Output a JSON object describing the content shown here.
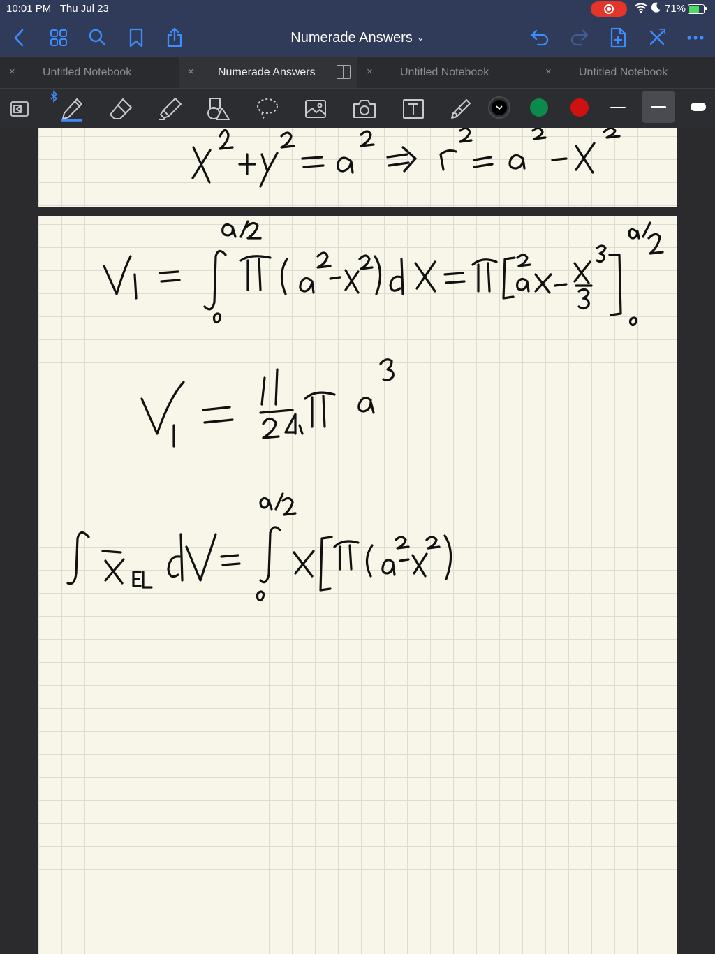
{
  "status_bar": {
    "time": "10:01 PM",
    "date": "Thu Jul 23",
    "battery": "71%",
    "record_color": "#e5352b"
  },
  "nav": {
    "title": "Numerade Answers",
    "title_chevron": "⌄",
    "icons": [
      "back-icon",
      "grid-icon",
      "search-icon",
      "bookmark-icon",
      "share-icon",
      "undo-icon",
      "redo-icon",
      "add-page-icon",
      "close-icon",
      "more-icon"
    ]
  },
  "tabs": [
    {
      "label": "Untitled Notebook",
      "close": "×",
      "active": false
    },
    {
      "label": "Numerade Answers",
      "close": "×",
      "active": true
    },
    {
      "label": "Untitled Notebook",
      "close": "×",
      "active": false
    },
    {
      "label": "Untitled Notebook",
      "close": "×",
      "active": false
    }
  ],
  "toolbar": {
    "tools": [
      "zoom-box",
      "pen",
      "eraser",
      "highlighter",
      "shapes",
      "lasso",
      "image",
      "camera",
      "text",
      "laser-pointer"
    ],
    "selected_tool": "pen",
    "colors": [
      "#000000",
      "#0c8a4c",
      "#d01111"
    ],
    "selected_color": "#000000",
    "stroke_widths": [
      "thin",
      "medium",
      "thick"
    ],
    "selected_width": "medium",
    "accent": "#3f8cff"
  }
}
